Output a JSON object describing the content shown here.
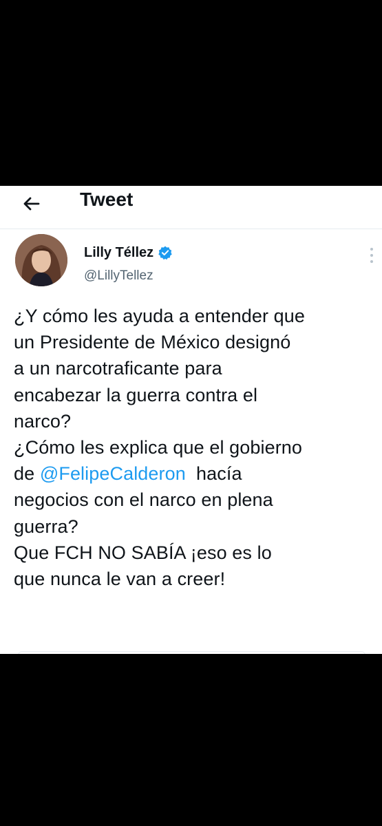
{
  "header": {
    "title": "Tweet",
    "back_icon": "arrow-left-icon"
  },
  "tweet": {
    "author": {
      "name": "Lilly Téllez",
      "handle": "@LillyTellez",
      "verified_icon": "verified-badge-icon"
    },
    "more_icon": "more-vertical-icon",
    "text": {
      "line1": "¿Y cómo les ayuda a entender que",
      "line2": "un Presidente de México designó",
      "line3": "a un narcotraficante para",
      "line4": "encabezar la guerra contra el",
      "line5": "narco?",
      "line6": "¿Cómo les explica que el gobierno",
      "line7_prefix": "de ",
      "line7_mention": "@FelipeCalderon",
      "line7_suffix": "  hacía",
      "line8": "negocios con el narco en plena",
      "line9": "guerra?",
      "line10": "Que FCH NO SABÍA ¡eso es lo",
      "line11": "que nunca le van a creer!"
    }
  },
  "colors": {
    "link": "#1d9bf0",
    "text": "#0f1419",
    "secondary": "#536471",
    "border": "#e6ecf0",
    "background_outer": "#000000"
  }
}
